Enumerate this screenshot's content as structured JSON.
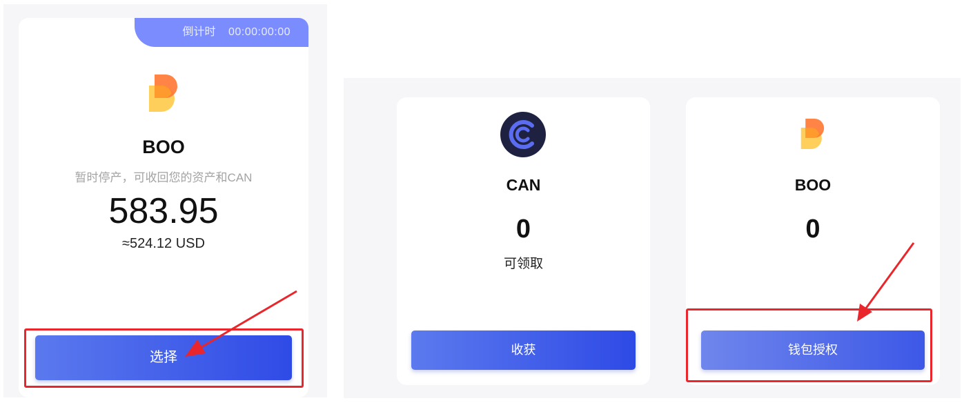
{
  "left_pool": {
    "countdown_label": "倒计时",
    "countdown_value": "00:00:00:00",
    "token_name": "BOO",
    "description": "暂时停产，可收回您的资产和CAN",
    "amount": "583.95",
    "usd_value": "≈524.12 USD",
    "select_button": "选择"
  },
  "can_card": {
    "token_name": "CAN",
    "amount": "0",
    "sub_label": "可领取",
    "harvest_button": "收获"
  },
  "boo_card": {
    "token_name": "BOO",
    "amount": "0",
    "approve_button": "钱包授权"
  },
  "colors": {
    "accent_blue": "#3450e7",
    "countdown_bg": "#7b8cff",
    "highlight_red": "#e8262b",
    "boo_orange": "#ff7a35",
    "boo_yellow": "#ffcf5c",
    "can_navy": "#1e2140"
  },
  "icons": [
    "boo-logo-icon",
    "can-logo-icon",
    "annotation-arrow-icon"
  ]
}
